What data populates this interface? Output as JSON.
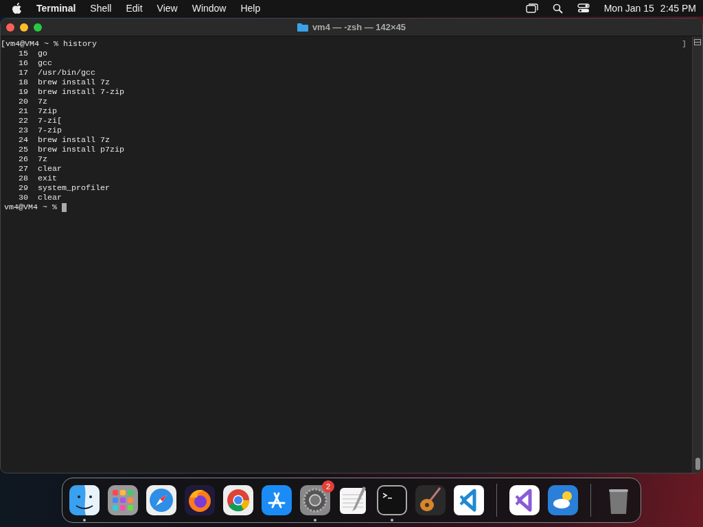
{
  "menu_bar": {
    "app_name": "Terminal",
    "menus": [
      "Shell",
      "Edit",
      "View",
      "Window",
      "Help"
    ],
    "date": "Mon Jan 15",
    "time": "2:45 PM"
  },
  "window": {
    "title": "vm4 — -zsh — 142×45",
    "marker": "]",
    "prompt_line": {
      "bracket": "[",
      "prompt": "vm4@VM4 ~ %",
      "command": "history"
    },
    "history": [
      {
        "number": "15",
        "command": "go"
      },
      {
        "number": "16",
        "command": "gcc"
      },
      {
        "number": "17",
        "command": "/usr/bin/gcc"
      },
      {
        "number": "18",
        "command": "brew install 7z"
      },
      {
        "number": "19",
        "command": "brew install 7-zip"
      },
      {
        "number": "20",
        "command": "7z"
      },
      {
        "number": "21",
        "command": "7zip"
      },
      {
        "number": "22",
        "command": "7-zi["
      },
      {
        "number": "23",
        "command": "7-zip"
      },
      {
        "number": "24",
        "command": "brew install 7z"
      },
      {
        "number": "25",
        "command": "brew install p7zip"
      },
      {
        "number": "26",
        "command": "7z"
      },
      {
        "number": "27",
        "command": "clear"
      },
      {
        "number": "28",
        "command": "exit"
      },
      {
        "number": "29",
        "command": "system_profiler"
      },
      {
        "number": "30",
        "command": "clear"
      }
    ],
    "current_prompt": "vm4@VM4 ~ %"
  },
  "dock": [
    {
      "kind": "finder",
      "running": true
    },
    {
      "kind": "launchpad",
      "running": false
    },
    {
      "kind": "safari",
      "running": false
    },
    {
      "kind": "firefox",
      "running": false
    },
    {
      "kind": "chrome",
      "running": false
    },
    {
      "kind": "appstore",
      "running": false
    },
    {
      "kind": "settings",
      "running": true,
      "badge": "2"
    },
    {
      "kind": "textedit",
      "running": false
    },
    {
      "kind": "terminal",
      "running": true
    },
    {
      "kind": "guitar",
      "running": false
    },
    {
      "kind": "vscode",
      "running": false
    },
    {
      "kind": "separator"
    },
    {
      "kind": "visualstudio",
      "running": false
    },
    {
      "kind": "weather",
      "running": false
    },
    {
      "kind": "separator"
    },
    {
      "kind": "trash",
      "running": false
    }
  ]
}
